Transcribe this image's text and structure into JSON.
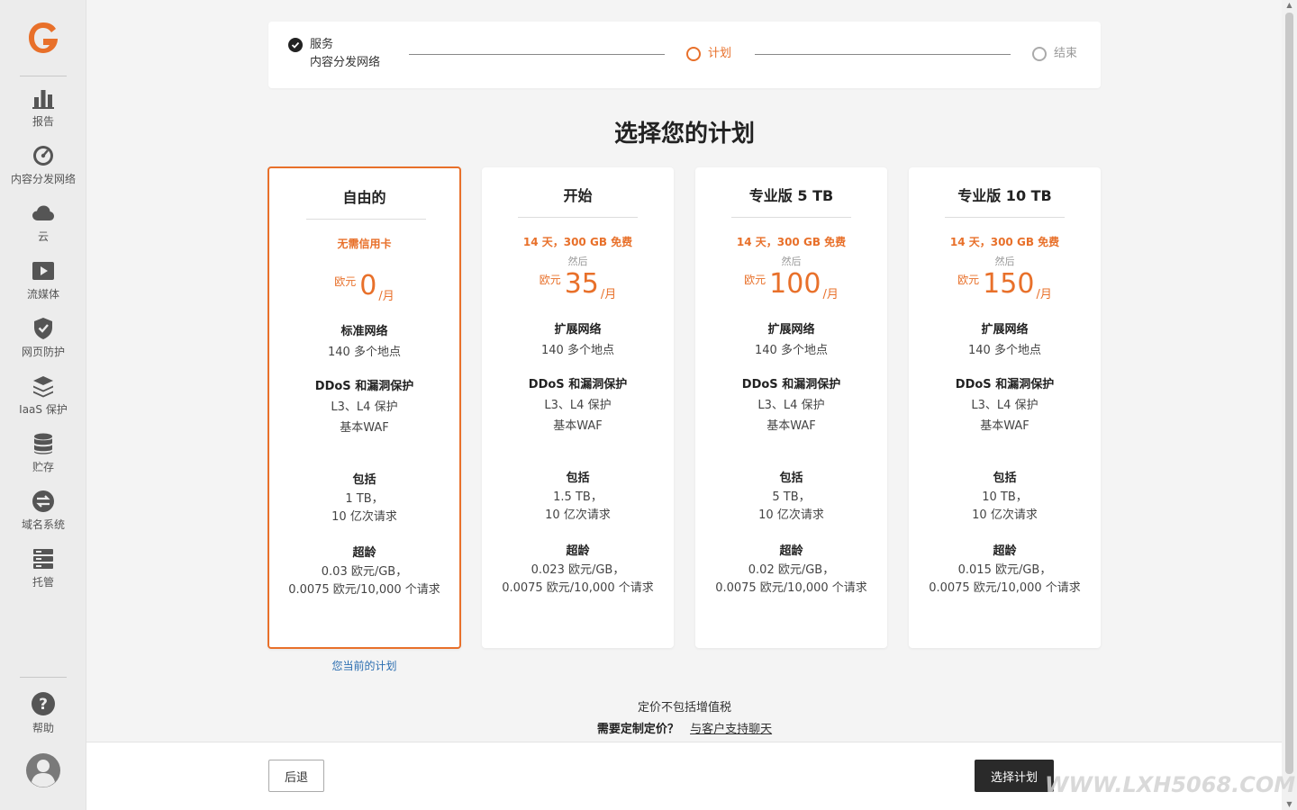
{
  "sidebar": {
    "items": [
      {
        "label": "报告",
        "icon": "bar-chart-icon"
      },
      {
        "label": "内容分发网络",
        "icon": "speedometer-icon"
      },
      {
        "label": "云",
        "icon": "cloud-icon"
      },
      {
        "label": "流媒体",
        "icon": "play-icon"
      },
      {
        "label": "网页防护",
        "icon": "shield-icon"
      },
      {
        "label": "IaaS 保护",
        "icon": "layers-icon"
      },
      {
        "label": "贮存",
        "icon": "database-icon"
      },
      {
        "label": "域名系统",
        "icon": "swap-icon"
      },
      {
        "label": "托管",
        "icon": "server-icon"
      }
    ],
    "help_label": "帮助"
  },
  "stepper": {
    "step1_title": "服务",
    "step1_subtitle": "内容分发网络",
    "step2_label": "计划",
    "step3_label": "结束"
  },
  "page_title": "选择您的计划",
  "plans": [
    {
      "title": "自由的",
      "promo": "无需信用卡",
      "then": "",
      "currency": "欧元",
      "price": "0",
      "unit": "/月",
      "network_title": "标准网络",
      "network_desc": "140 多个地点",
      "ddos_title": "DDoS 和漏洞保护",
      "ddos_line1": "L3、L4 保护",
      "ddos_line2": "基本WAF",
      "included_title": "包括",
      "included_line1": "1 TB，",
      "included_line2": "10 亿次请求",
      "overage_title": "超龄",
      "overage_line1": "0.03 欧元/GB，",
      "overage_line2": "0.0075 欧元/10,000 个请求"
    },
    {
      "title": "开始",
      "promo": "14 天，300 GB 免费",
      "then": "然后",
      "currency": "欧元",
      "price": "35",
      "unit": "/月",
      "network_title": "扩展网络",
      "network_desc": "140 多个地点",
      "ddos_title": "DDoS 和漏洞保护",
      "ddos_line1": "L3、L4 保护",
      "ddos_line2": "基本WAF",
      "included_title": "包括",
      "included_line1": "1.5 TB，",
      "included_line2": "10 亿次请求",
      "overage_title": "超龄",
      "overage_line1": "0.023 欧元/GB，",
      "overage_line2": "0.0075 欧元/10,000 个请求"
    },
    {
      "title": "专业版 5 TB",
      "promo": "14 天，300 GB 免费",
      "then": "然后",
      "currency": "欧元",
      "price": "100",
      "unit": "/月",
      "network_title": "扩展网络",
      "network_desc": "140 多个地点",
      "ddos_title": "DDoS 和漏洞保护",
      "ddos_line1": "L3、L4 保护",
      "ddos_line2": "基本WAF",
      "included_title": "包括",
      "included_line1": "5 TB，",
      "included_line2": "10 亿次请求",
      "overage_title": "超龄",
      "overage_line1": "0.02 欧元/GB，",
      "overage_line2": "0.0075 欧元/10,000 个请求"
    },
    {
      "title": "专业版 10 TB",
      "promo": "14 天，300 GB 免费",
      "then": "然后",
      "currency": "欧元",
      "price": "150",
      "unit": "/月",
      "network_title": "扩展网络",
      "network_desc": "140 多个地点",
      "ddos_title": "DDoS 和漏洞保护",
      "ddos_line1": "L3、L4 保护",
      "ddos_line2": "基本WAF",
      "included_title": "包括",
      "included_line1": "10 TB，",
      "included_line2": "10 亿次请求",
      "overage_title": "超龄",
      "overage_line1": "0.015 欧元/GB，",
      "overage_line2": "0.0075 欧元/10,000 个请求"
    }
  ],
  "current_plan_label": "您当前的计划",
  "pricing_note": "定价不包括增值税",
  "custom_pricing_question": "需要定制定价？",
  "custom_pricing_link": "与客户支持聊天",
  "buttons": {
    "back": "后退",
    "select_plan": "选择计划"
  },
  "watermark": "WWW.LXH5068.COM",
  "colors": {
    "accent": "#e8702a",
    "link": "#2a6db0",
    "primary_button": "#2a2a2a"
  }
}
